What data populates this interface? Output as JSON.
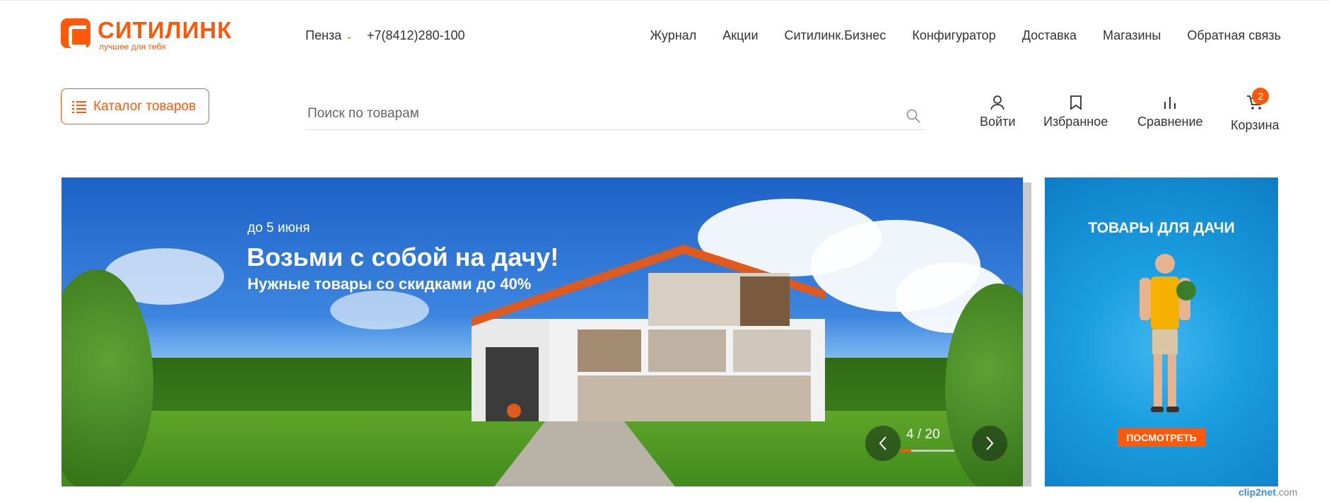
{
  "brand": {
    "name": "СИТИЛИНК",
    "slogan": "лучшее для тебя",
    "accent_color": "#fc5a0a"
  },
  "header": {
    "city": "Пенза",
    "phone": "+7(8412)280-100",
    "nav": [
      "Журнал",
      "Акции",
      "Ситилинк.Бизнес",
      "Конфигуратор",
      "Доставка",
      "Магазины",
      "Обратная связь"
    ]
  },
  "catalog": {
    "label": "Каталог товаров",
    "icon": "list-icon"
  },
  "search": {
    "placeholder": "Поиск по товарам",
    "value": "",
    "icon": "search-icon"
  },
  "actions": {
    "login": {
      "label": "Войти",
      "icon": "user-icon"
    },
    "favorites": {
      "label": "Избранное",
      "icon": "bookmark-icon"
    },
    "compare": {
      "label": "Сравнение",
      "icon": "bar-chart-icon"
    },
    "cart": {
      "label": "Корзина",
      "icon": "cart-icon",
      "count": "2"
    }
  },
  "banner": {
    "date": "до 5 июня",
    "title": "Возьми с собой на дачу!",
    "subtitle": "Нужные товары со скидками до 40%",
    "counter": "4 / 20",
    "progress": 0.2
  },
  "side_banner": {
    "title": "ТОВАРЫ ДЛЯ ДАЧИ",
    "button": "ПОСМОТРЕТЬ"
  },
  "watermark": {
    "brand": "clip2net",
    "suffix": ".com"
  }
}
